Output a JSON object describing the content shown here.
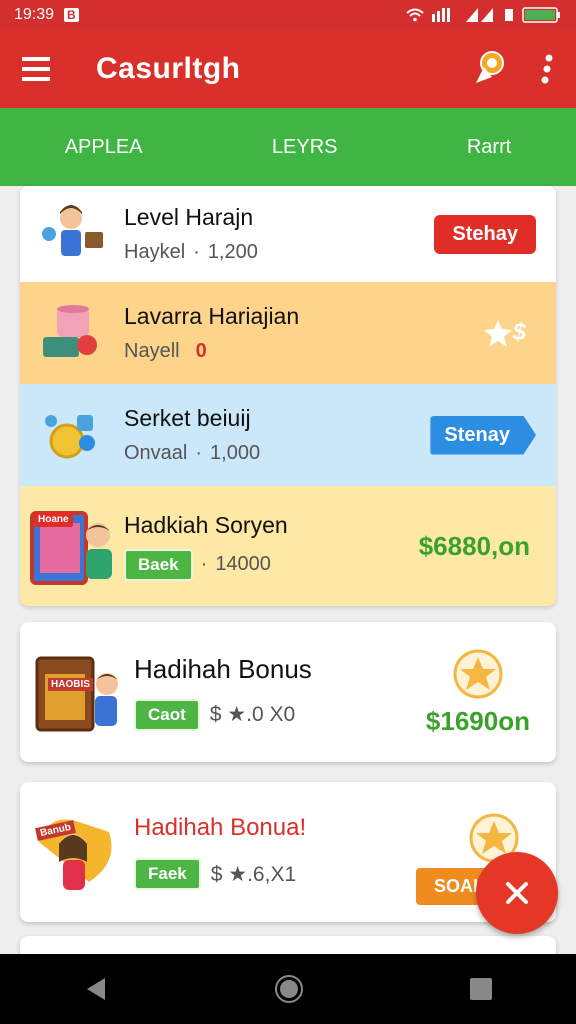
{
  "status_bar": {
    "time": "19:39",
    "notif_glyph": "B",
    "battery_text": ""
  },
  "app_bar": {
    "title": "Casurltgh"
  },
  "tabs": [
    {
      "label": "APPLEA"
    },
    {
      "label": "LEYRS"
    },
    {
      "label": "Rarrt"
    }
  ],
  "items": [
    {
      "title": "Level Harajn",
      "sub_label": "Haykel",
      "sub_value": "1,200",
      "action": "Stehay"
    },
    {
      "title": "Lavarra Hariajian",
      "sub_label": "Nayell",
      "sub_value": "0",
      "action_icon": "star-dollar-icon",
      "action_glyph": "$"
    },
    {
      "title": "Serket beiuij",
      "sub_label": "Onvaal",
      "sub_value": "1,000",
      "action": "Stenay"
    },
    {
      "title": "Hadkiah Soryen",
      "tag": "Baek",
      "sub_value": "14000",
      "amount": "$6880,on",
      "art_label": "Hoane"
    },
    {
      "title": "Hadihah Bonus",
      "tag": "Caot",
      "sub_value": "$ ★.0 X0",
      "amount": "$1690on",
      "art_label": "HAOBIS"
    },
    {
      "title": "Hadihah Bonua!",
      "tag": "Faek",
      "sub_value": "$ ★.6,X1",
      "amount_badge": "SOAH",
      "art_label": "Banub"
    }
  ],
  "colors": {
    "app_red": "#d9302c",
    "tab_green": "#3fb543",
    "money_green": "#3aa12a"
  }
}
